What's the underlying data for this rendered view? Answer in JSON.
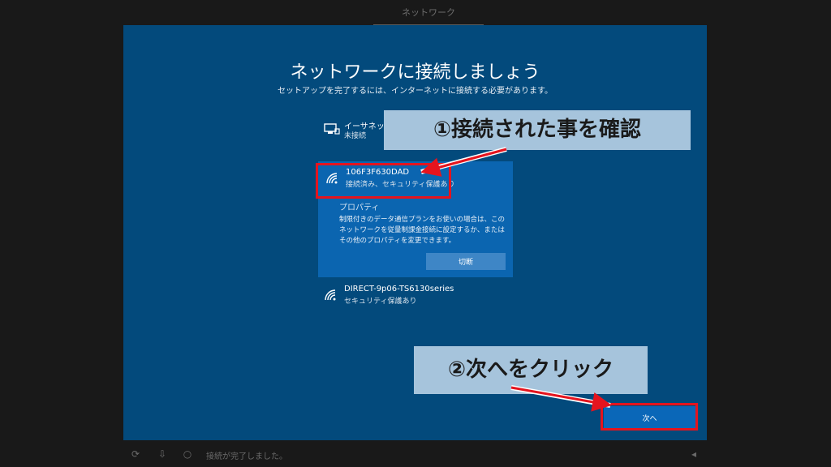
{
  "top_tab": {
    "label": "ネットワーク"
  },
  "page": {
    "title": "ネットワークに接続しましょう",
    "subtitle": "セットアップを完了するには、インターネットに接続する必要があります。"
  },
  "networks": [
    {
      "name": "イーサネット",
      "status": "未接続",
      "icon": "ethernet-icon"
    },
    {
      "name": "106F3F630DAD",
      "status": "接続済み、セキュリティ保護あり",
      "icon": "wifi-icon"
    },
    {
      "name": "DIRECT-9p06-TS6130series",
      "status": "セキュリティ保護あり",
      "icon": "wifi-icon"
    }
  ],
  "selected_panel": {
    "properties_label": "プロパティ",
    "description": "制限付きのデータ通信プランをお使いの場合は、このネットワークを従量制課金接続に設定するか、またはその他のプロパティを変更できます。",
    "disconnect_label": "切断"
  },
  "next_label": "次へ",
  "annotations": {
    "step1": "①接続された事を確認",
    "step2": "②次へをクリック",
    "highlight_color": "#e5141e",
    "callout_bg": "#a6c4dc"
  },
  "bottom_bar": {
    "status_text": "接続が完了しました。",
    "icons": [
      "accessibility-icon",
      "microphone-icon",
      "power-icon",
      "volume-icon"
    ]
  },
  "colors": {
    "background": "#034a7c",
    "selected": "#0b65b0",
    "button": "#0a67b8"
  }
}
